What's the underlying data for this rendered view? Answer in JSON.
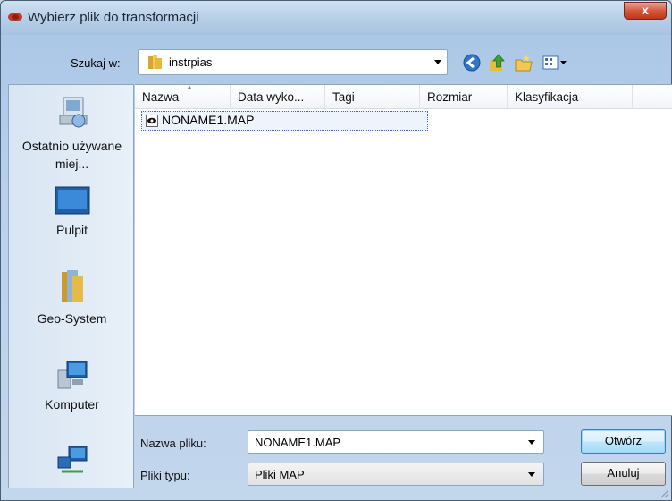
{
  "window": {
    "title": "Wybierz plik do transformacji",
    "close_label": "x"
  },
  "lookin": {
    "label": "Szukaj w:",
    "value": "instrpias"
  },
  "toolbar": {
    "icons": [
      "back-icon",
      "up-folder-icon",
      "new-folder-icon",
      "views-menu-icon"
    ]
  },
  "places": [
    {
      "label": "Ostatnio używane miej...",
      "icon": "recent-places-icon"
    },
    {
      "label": "Pulpit",
      "icon": "desktop-icon"
    },
    {
      "label": "Geo-System",
      "icon": "user-folder-icon"
    },
    {
      "label": "Komputer",
      "icon": "computer-icon"
    },
    {
      "label": "",
      "icon": "network-icon"
    }
  ],
  "columns": [
    "Nazwa",
    "Data wyko...",
    "Tagi",
    "Rozmiar",
    "Klasyfikacja"
  ],
  "files": [
    {
      "name": "NONAME1.MAP",
      "icon": "map-file-icon"
    }
  ],
  "filename": {
    "label": "Nazwa pliku:",
    "value": "NONAME1.MAP"
  },
  "filetype": {
    "label": "Pliki typu:",
    "value": "Pliki MAP"
  },
  "buttons": {
    "open": "Otwórz",
    "cancel": "Anuluj"
  },
  "colors": {
    "selection_border": "#3a6ab5",
    "close_button": "#c0371b",
    "frame": "#b9d1ea"
  }
}
